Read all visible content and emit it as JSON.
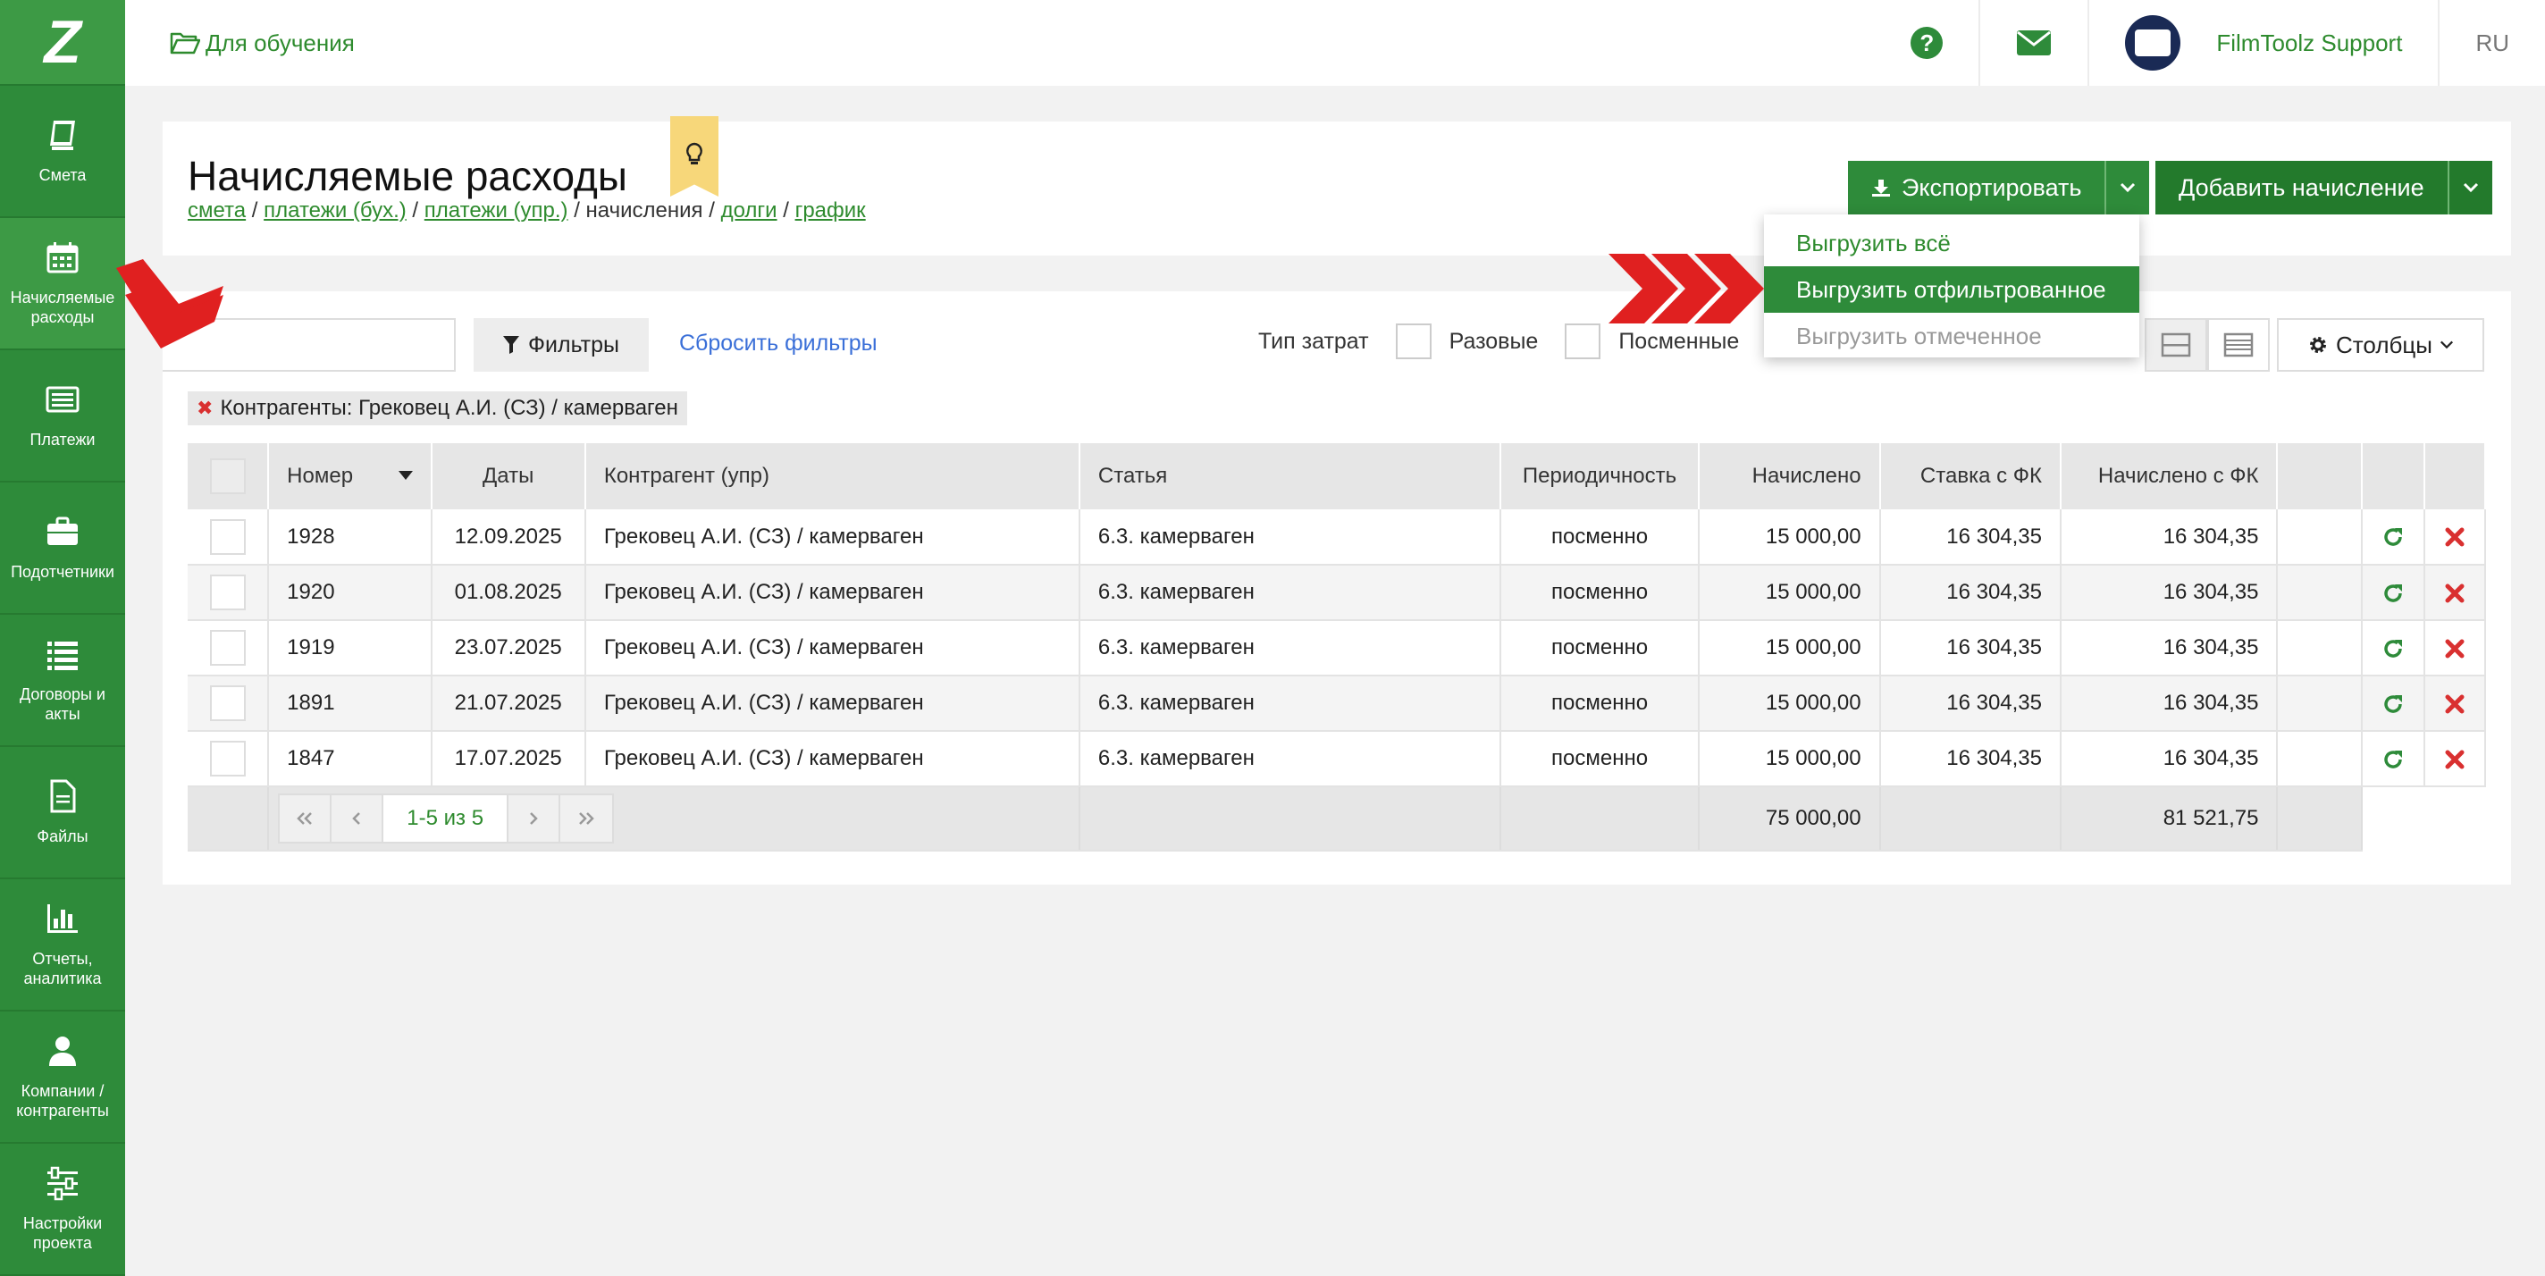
{
  "sidebar": {
    "items": [
      {
        "label": "Смета",
        "icon": "book-icon"
      },
      {
        "label": "Начисляемые расходы",
        "icon": "calendar-icon"
      },
      {
        "label": "Платежи",
        "icon": "list-card-icon"
      },
      {
        "label": "Подотчетники",
        "icon": "briefcase-icon"
      },
      {
        "label": "Договоры и акты",
        "icon": "list-icon"
      },
      {
        "label": "Файлы",
        "icon": "file-icon"
      },
      {
        "label": "Отчеты, аналитика",
        "icon": "bar-chart-icon"
      },
      {
        "label": "Компании / контрагенты",
        "icon": "user-icon"
      },
      {
        "label": "Настройки проекта",
        "icon": "sliders-icon"
      }
    ]
  },
  "topbar": {
    "project": "Для обучения",
    "user": "FilmToolz Support",
    "lang": "RU"
  },
  "header": {
    "title": "Начисляемые расходы",
    "breadcrumb": [
      "смета",
      "платежи (бух.)",
      "платежи (упр.)",
      "начисления",
      "долги",
      "график"
    ],
    "export_label": "Экспортировать",
    "add_label": "Добавить начисление"
  },
  "export_menu": {
    "items": [
      "Выгрузить всё",
      "Выгрузить отфильтрованное",
      "Выгрузить отмеченное"
    ]
  },
  "filters": {
    "filter_btn": "Фильтры",
    "reset": "Сбросить фильтры",
    "type_label": "Тип затрат",
    "opt1": "Разовые",
    "opt2": "Посменные",
    "columns_btn": "Столбцы",
    "chip_label": "Контрагенты:",
    "chip_value": "Грековец А.И. (СЗ) / камерваген"
  },
  "table": {
    "headers": [
      "Номер",
      "Даты",
      "Контрагент (упр)",
      "Статья",
      "Периодичность",
      "Начислено",
      "Ставка с ФК",
      "Начислено с ФК"
    ],
    "rows": [
      {
        "num": "1928",
        "date": "12.09.2025",
        "party": "Грековец А.И. (СЗ) / камерваген",
        "item": "6.3. камерваген",
        "period": "посменно",
        "accrued": "15 000,00",
        "rate": "16 304,35",
        "accrued_fk": "16 304,35"
      },
      {
        "num": "1920",
        "date": "01.08.2025",
        "party": "Грековец А.И. (СЗ) / камерваген",
        "item": "6.3. камерваген",
        "period": "посменно",
        "accrued": "15 000,00",
        "rate": "16 304,35",
        "accrued_fk": "16 304,35"
      },
      {
        "num": "1919",
        "date": "23.07.2025",
        "party": "Грековец А.И. (СЗ) / камерваген",
        "item": "6.3. камерваген",
        "period": "посменно",
        "accrued": "15 000,00",
        "rate": "16 304,35",
        "accrued_fk": "16 304,35"
      },
      {
        "num": "1891",
        "date": "21.07.2025",
        "party": "Грековец А.И. (СЗ) / камерваген",
        "item": "6.3. камерваген",
        "period": "посменно",
        "accrued": "15 000,00",
        "rate": "16 304,35",
        "accrued_fk": "16 304,35"
      },
      {
        "num": "1847",
        "date": "17.07.2025",
        "party": "Грековец А.И. (СЗ) / камерваген",
        "item": "6.3. камерваген",
        "period": "посменно",
        "accrued": "15 000,00",
        "rate": "16 304,35",
        "accrued_fk": "16 304,35"
      }
    ],
    "pager": "1-5 из 5",
    "total_accrued": "75 000,00",
    "total_accrued_fk": "81 521,75"
  },
  "colors": {
    "brand_green": "#2e8b3a",
    "link_blue": "#3a6fd8",
    "delete_red": "#d93030",
    "annotation_red": "#e02020"
  }
}
